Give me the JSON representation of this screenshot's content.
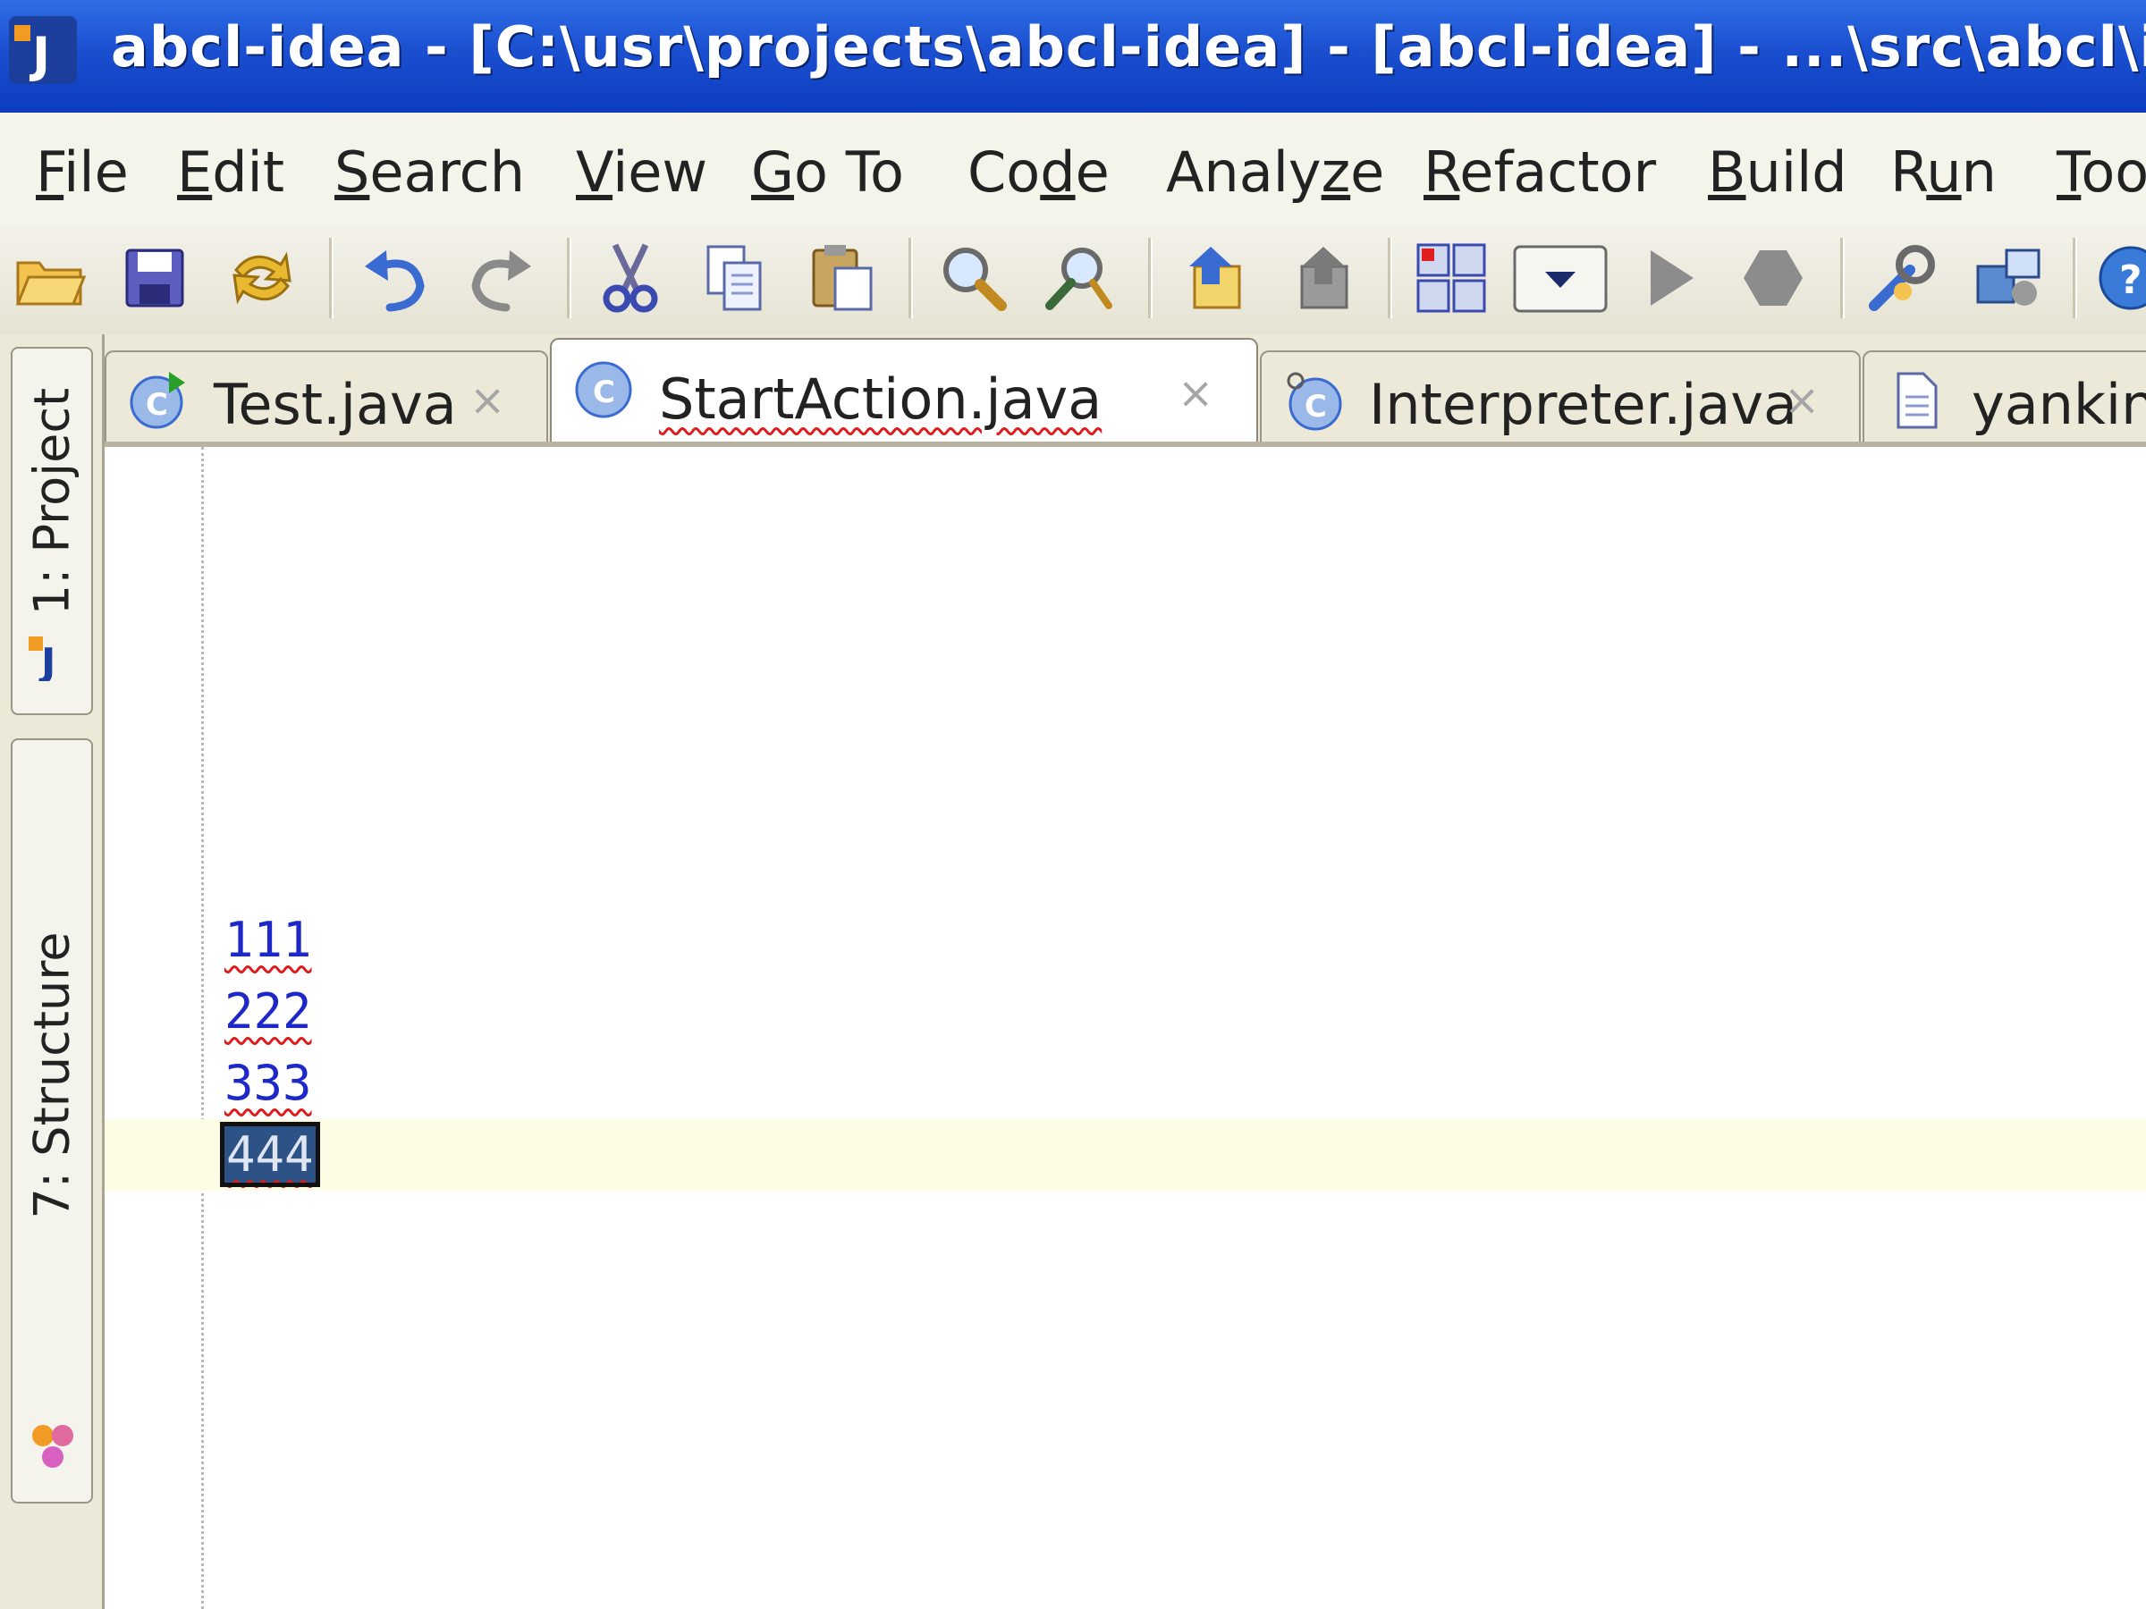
{
  "window": {
    "title": "abcl-idea - [C:\\usr\\projects\\abcl-idea] - [abcl-idea] - ...\\src\\abcl\\idea\\StartAction.java - IntelliJ IDEA"
  },
  "menu": {
    "items": [
      {
        "mnemonic": "F",
        "rest": "ile"
      },
      {
        "mnemonic": "E",
        "rest": "dit"
      },
      {
        "mnemonic": "S",
        "rest": "earch"
      },
      {
        "mnemonic": "V",
        "rest": "iew"
      },
      {
        "mnemonic": "G",
        "rest": "o To"
      },
      {
        "pre": "Co",
        "mnemonic": "d",
        "rest": "e"
      },
      {
        "pre": "Analy",
        "mnemonic": "z",
        "rest": "e"
      },
      {
        "mnemonic": "R",
        "rest": "efactor"
      },
      {
        "mnemonic": "B",
        "rest": "uild"
      },
      {
        "pre": "R",
        "mnemonic": "u",
        "rest": "n"
      },
      {
        "mnemonic": "T",
        "rest": "oo"
      }
    ]
  },
  "toolbar": {
    "icons": [
      "open-folder-icon",
      "save-icon",
      "sync-icon",
      "undo-icon",
      "redo-icon",
      "cut-icon",
      "copy-icon",
      "paste-icon",
      "find-icon",
      "find-usages-icon",
      "back-icon",
      "forward-icon",
      "make-icon",
      "run-config-dropdown-icon",
      "run-icon",
      "debug-icon",
      "settings-icon",
      "project-structure-icon",
      "help-icon"
    ]
  },
  "left_panel": {
    "tabs": [
      {
        "label": "1: Project",
        "icon": "project-icon"
      },
      {
        "label": "7: Structure",
        "icon": "structure-icon"
      }
    ]
  },
  "editor_tabs": [
    {
      "label": "Test.java",
      "close": "×",
      "icon": "test-class-icon",
      "active": false
    },
    {
      "label": "StartAction.java",
      "close": "×",
      "icon": "class-icon",
      "active": true
    },
    {
      "label": "Interpreter.java",
      "close": "×",
      "icon": "class-icon",
      "active": false
    },
    {
      "label": "yanking.lisp",
      "close": "",
      "icon": "file-icon",
      "active": false
    }
  ],
  "editor": {
    "lines": [
      "111",
      "222",
      "333",
      "444"
    ],
    "selected_line": 3
  },
  "colors": {
    "titlebar": "#1a4fd0",
    "selection": "#2c5286",
    "code_text": "#1e28c8",
    "caret_row": "#fdfde6",
    "error_underline": "#e01b1b"
  }
}
